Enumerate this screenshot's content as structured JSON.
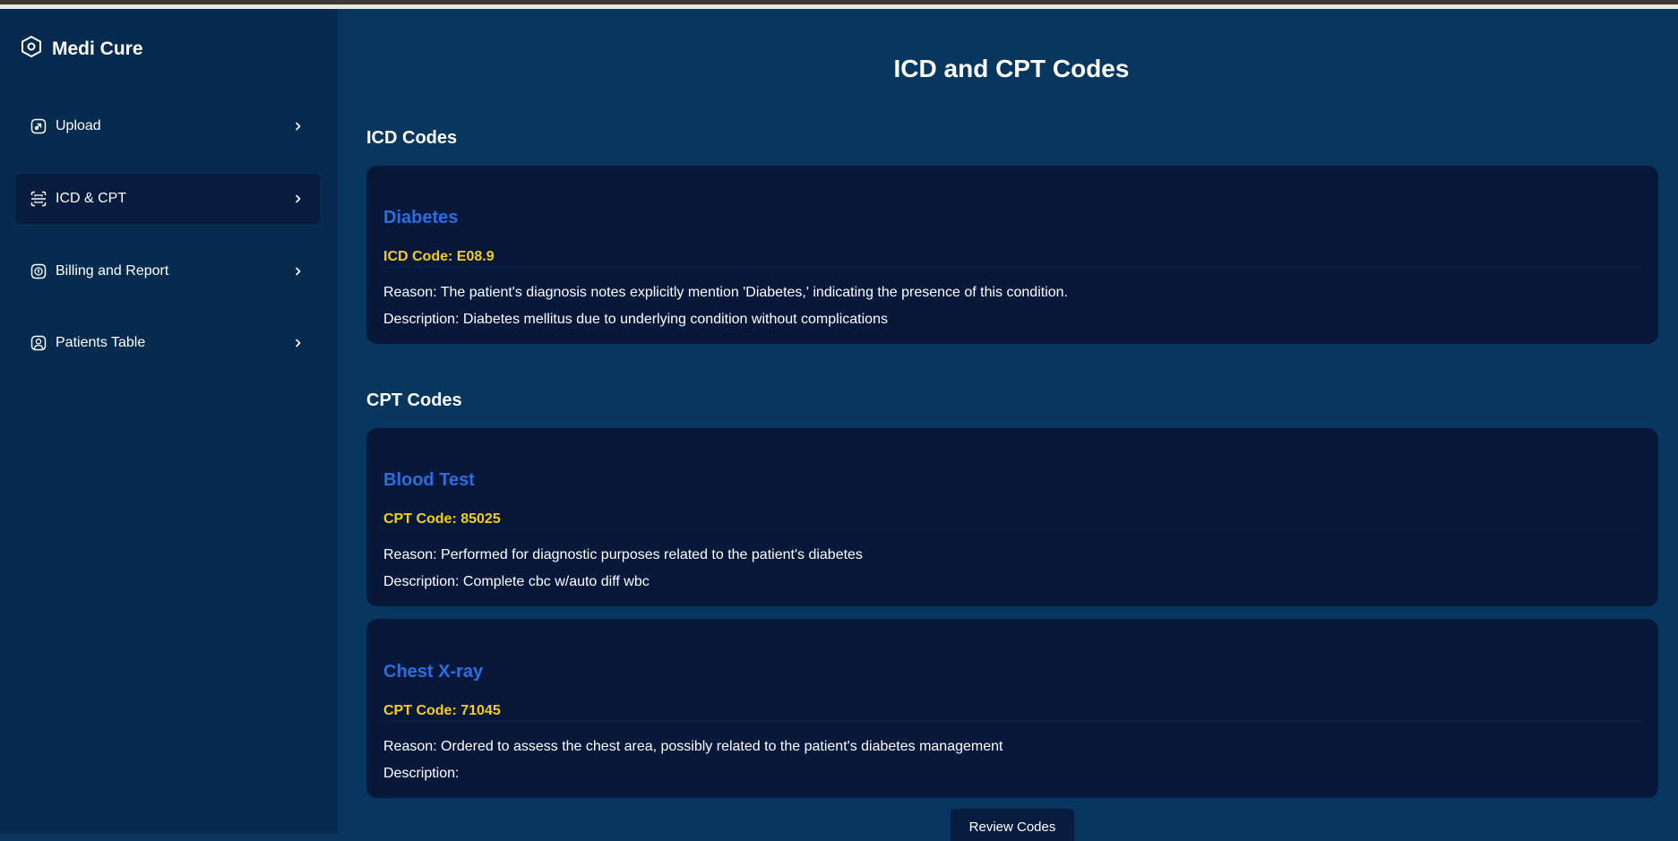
{
  "app": {
    "name": "Medi Cure"
  },
  "sidebar": {
    "items": [
      {
        "label": "Upload",
        "icon": "upload-icon"
      },
      {
        "label": "ICD & CPT",
        "icon": "scan-icon",
        "active": true
      },
      {
        "label": "Billing and Report",
        "icon": "billing-icon"
      },
      {
        "label": "Patients Table",
        "icon": "user-icon"
      }
    ]
  },
  "main": {
    "title": "ICD and CPT Codes",
    "icd_section": {
      "title": "ICD Codes",
      "cards": [
        {
          "name": "Diabetes",
          "code": "ICD Code: E08.9",
          "reason": "Reason: The patient's diagnosis notes explicitly mention 'Diabetes,' indicating the presence of this condition.",
          "description": "Description: Diabetes mellitus due to underlying condition without complications"
        }
      ]
    },
    "cpt_section": {
      "title": "CPT Codes",
      "cards": [
        {
          "name": "Blood Test",
          "code": "CPT Code: 85025",
          "reason": "Reason: Performed for diagnostic purposes related to the patient's diabetes",
          "description": "Description: Complete cbc w/auto diff wbc"
        },
        {
          "name": "Chest X-ray",
          "code": "CPT Code: 71045",
          "reason": "Reason: Ordered to assess the chest area, possibly related to the patient's diabetes management",
          "description": "Description:"
        }
      ]
    },
    "review_button": "Review Codes"
  },
  "colors": {
    "sidebar_bg": "#062b4f",
    "main_bg": "#07365f",
    "card_bg": "#07183a",
    "card_title": "#2d6de0",
    "code_text": "#f6cd13"
  }
}
